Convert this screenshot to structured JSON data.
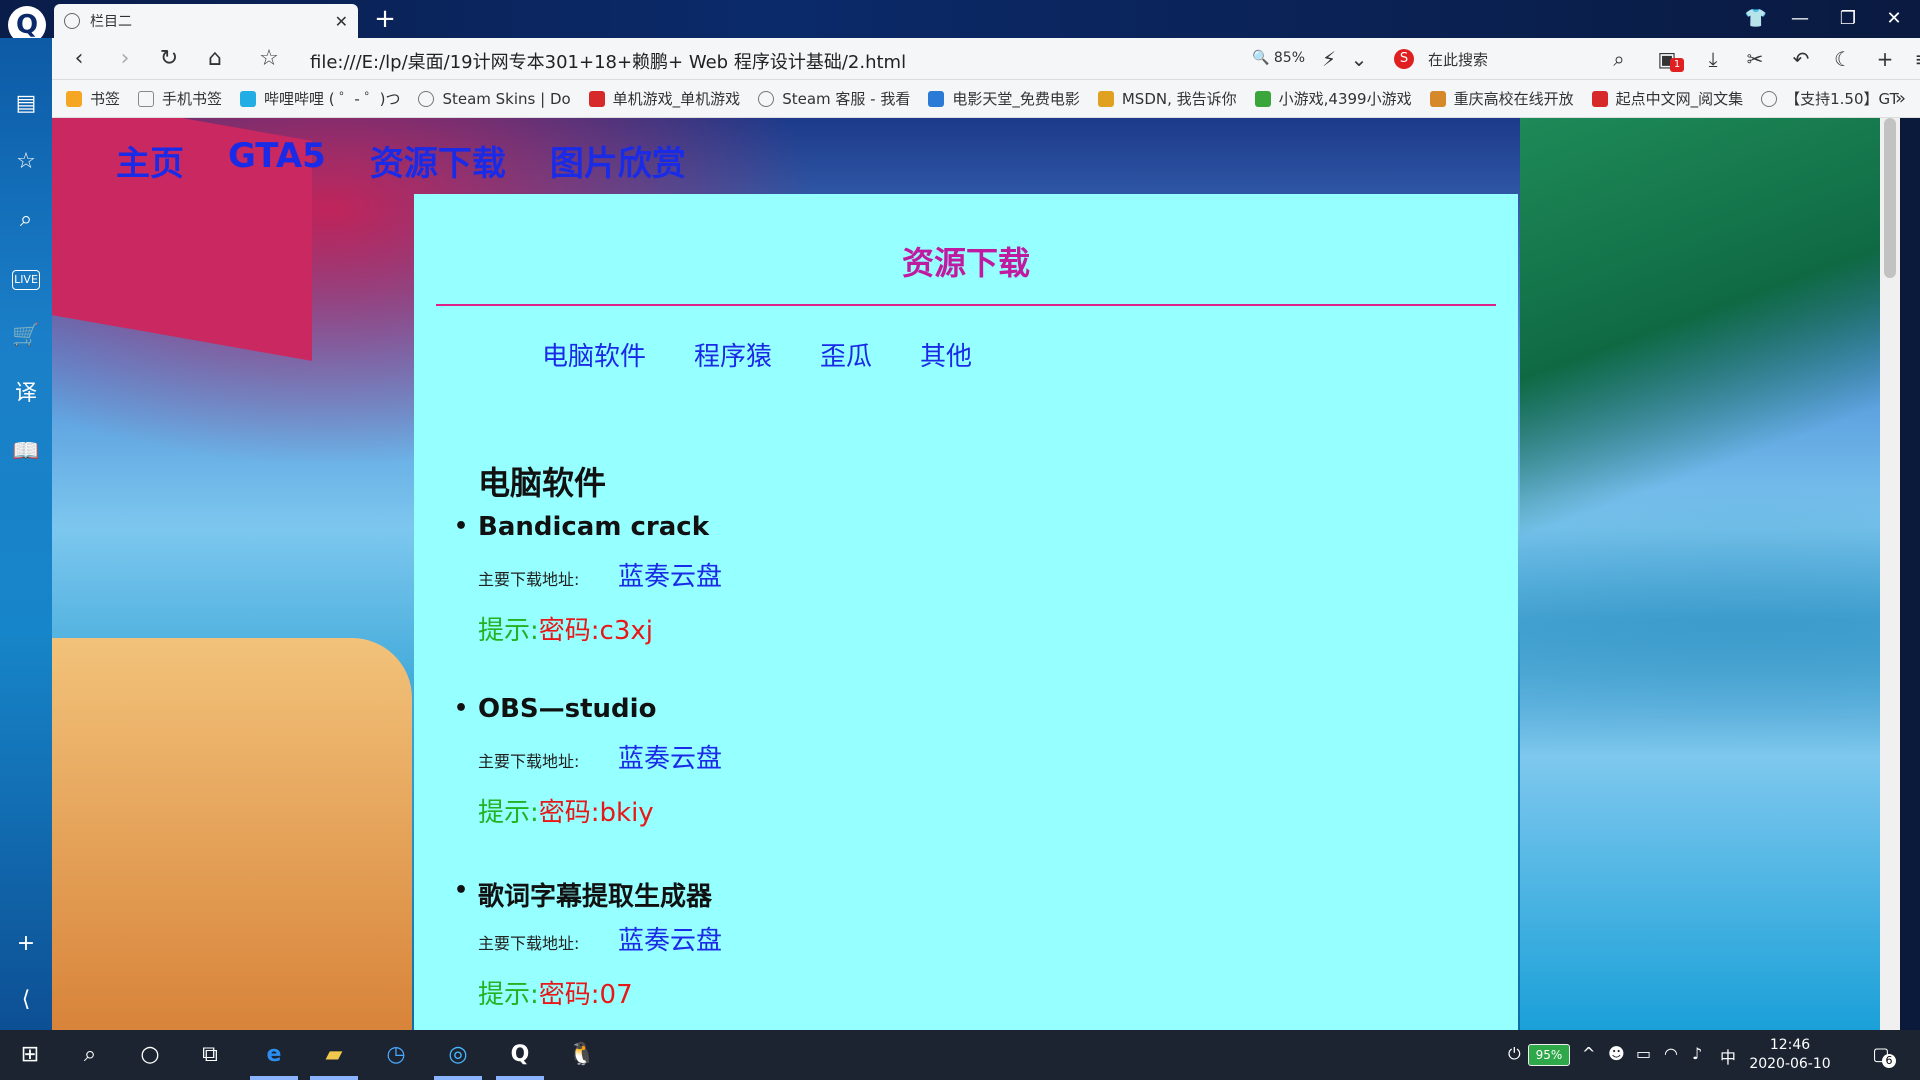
{
  "browser": {
    "tab_title": "栏目二",
    "url": "file:///E:/lp/桌面/19计网专本301+18+赖鹏+ Web 程序设计基础/2.html",
    "zoom": "85%",
    "search_placeholder": "在此搜索",
    "download_badge": "1"
  },
  "bookmarks": [
    {
      "label": "书签",
      "color": "#f5a623"
    },
    {
      "label": "手机书签",
      "color": "#888888"
    },
    {
      "label": "哔哩哔哩 ( ゜- ゜)つ",
      "color": "#23ade5"
    },
    {
      "label": "Steam Skins | Do",
      "color": "#777777"
    },
    {
      "label": "单机游戏_单机游戏",
      "color": "#d62a2a"
    },
    {
      "label": "Steam 客服 - 我看",
      "color": "#777777"
    },
    {
      "label": "电影天堂_免费电影",
      "color": "#2a7ad6"
    },
    {
      "label": "MSDN, 我告诉你",
      "color": "#e0a020"
    },
    {
      "label": "小游戏,4399小游戏",
      "color": "#3aa53a"
    },
    {
      "label": "重庆高校在线开放",
      "color": "#d6892a"
    },
    {
      "label": "起点中文网_阅文集",
      "color": "#d62a2a"
    },
    {
      "label": "【支持1.50】GT",
      "color": "#777777"
    }
  ],
  "page": {
    "nav": [
      "主页",
      "GTA5",
      "资源下载",
      "图片欣赏"
    ],
    "panel_title": "资源下载",
    "sub_nav": [
      "电脑软件",
      "程序猿",
      "歪瓜",
      "其他"
    ],
    "section_heading": "电脑软件",
    "items": [
      {
        "title": "Bandicam crack",
        "dl_label": "主要下载地址:",
        "dl_link": "蓝奏云盘",
        "hint_label": "提示:",
        "password": "密码:c3xj"
      },
      {
        "title": "OBS—studio",
        "dl_label": "主要下载地址:",
        "dl_link": "蓝奏云盘",
        "hint_label": "提示:",
        "password": "密码:bkiy"
      },
      {
        "title": "歌词字幕提取生成器",
        "dl_label": "主要下载地址:",
        "dl_link": "蓝奏云盘",
        "hint_label": "提示:",
        "password": "密码:07"
      }
    ]
  },
  "taskbar": {
    "battery": "95%",
    "ime": "中",
    "time": "12:46",
    "date": "2020-06-10",
    "notifications": "6"
  }
}
